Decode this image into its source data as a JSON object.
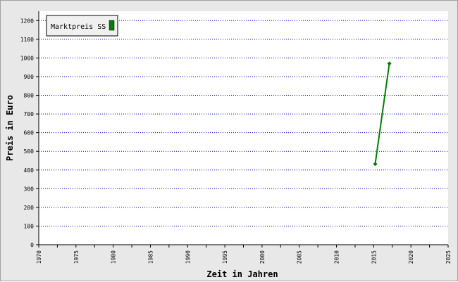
{
  "chart_data": {
    "type": "line",
    "xlabel": "Zeit in Jahren",
    "ylabel": "Preis in Euro",
    "xlim": [
      1970,
      2025
    ],
    "ylim": [
      0,
      1250
    ],
    "x_ticks": [
      1970,
      1975,
      1980,
      1985,
      1990,
      1995,
      2000,
      2005,
      2010,
      2015,
      2020,
      2025
    ],
    "y_ticks": [
      0,
      100,
      200,
      300,
      400,
      500,
      600,
      700,
      800,
      900,
      1000,
      1100,
      1200
    ],
    "grid": "horizontal dotted",
    "grid_color": "#0000cc",
    "legend_position": "top-left",
    "series": [
      {
        "name": "Marktpreis SS",
        "color": "#008000",
        "x": [
          2015.2,
          2017.1
        ],
        "y": [
          432,
          970
        ]
      }
    ]
  }
}
